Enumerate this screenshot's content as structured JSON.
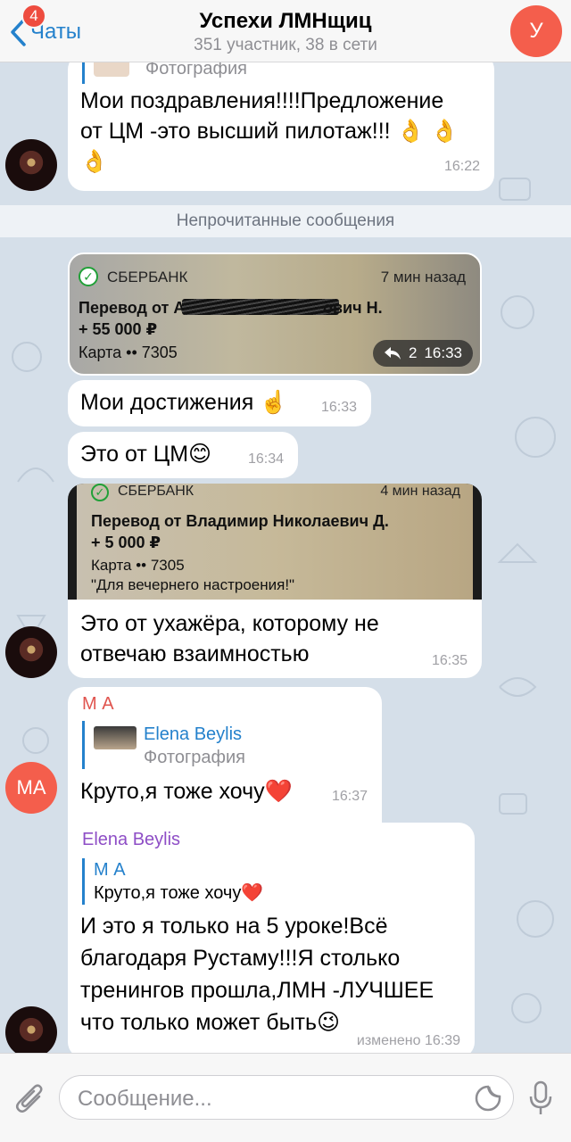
{
  "header": {
    "back_label": "Чаты",
    "unread_badge": "4",
    "title": "Успехи ЛМНщиц",
    "subtitle": "351 участник, 38 в сети",
    "avatar_letter": "У"
  },
  "messages": {
    "m1": {
      "reply_sub": "Фотография",
      "text_line1": "Мои поздравления!!!!Предложение",
      "text_line2": "от ЦМ -это высший пилотаж!!! 👌 👌",
      "text_line3": "👌",
      "time": "16:22"
    },
    "divider": "Непрочитанные сообщения",
    "card1": {
      "bank": "СБЕРБАНК",
      "ago": "7 мин назад",
      "line1": "Перевод от А",
      "line1_end": "ович Н.",
      "line2": "+ 55 000 ₽",
      "line3": "Карта •• 7305",
      "forward_count": "2",
      "time": "16:33"
    },
    "m2": {
      "text": "Мои достижения ☝️",
      "time": "16:33"
    },
    "m3": {
      "text": "Это от ЦМ😊",
      "time": "16:34"
    },
    "card2": {
      "bank": "СБЕРБАНК",
      "ago": "4 мин назад",
      "line1": "Перевод от Владимир Николаевич Д.",
      "line2": "+ 5 000 ₽",
      "line3": "Карта •• 7305",
      "line4": "\"Для вечернего настроения!\"",
      "text_line1": "Это от ухажёра, которому не",
      "text_line2": "отвечаю взаимностью",
      "time": "16:35"
    },
    "m4": {
      "sender": "М А",
      "reply_name": "Elena Beylis",
      "reply_sub": "Фотография",
      "text": "Круто,я тоже хочу❤️",
      "time": "16:37",
      "avatar": "МА"
    },
    "m5": {
      "sender": "Elena Beylis",
      "reply_name": "М А",
      "reply_sub": "Круто,я тоже хочу❤️",
      "text_line1": "И это я только на 5 уроке!Всё",
      "text_line2": "благодаря Рустаму!!!Я столько",
      "text_line3": "тренингов прошла,ЛМН -ЛУЧШЕЕ",
      "text_line4": "что только может быть😉",
      "time": "изменено 16:39"
    }
  },
  "input": {
    "placeholder": "Сообщение..."
  },
  "colors": {
    "accent": "#2481cc",
    "avatar_red": "#f45e4c",
    "sender_ma": "#e0544e",
    "sender_elena": "#8e4ec6"
  }
}
